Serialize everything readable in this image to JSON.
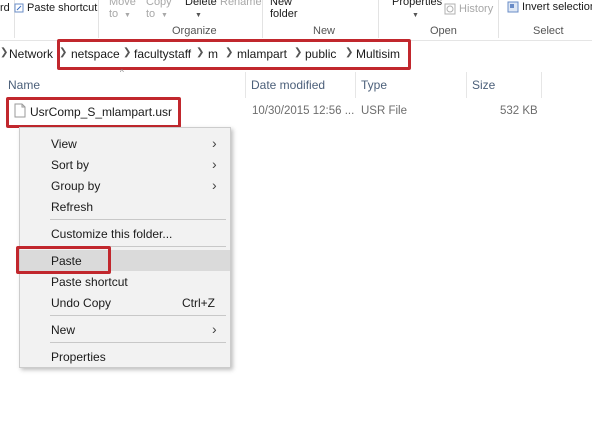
{
  "ribbon": {
    "clip_label": "rd",
    "paste_shortcut": "Paste shortcut",
    "move_to": [
      "Move",
      "to"
    ],
    "copy_to": [
      "Copy",
      "to"
    ],
    "delete": "Delete",
    "rename": "Rename",
    "new_folder": [
      "New",
      "folder"
    ],
    "properties": "Properties",
    "history": "History",
    "invert_selection": "Invert selection",
    "groups": {
      "organize": "Organize",
      "new": "New",
      "open": "Open",
      "select": "Select"
    }
  },
  "address": {
    "crumbs": [
      "Network",
      "netspace",
      "facultystaff",
      "m",
      "mlampart",
      "public",
      "Multisim"
    ]
  },
  "columns": {
    "name": "Name",
    "date": "Date modified",
    "type": "Type",
    "size": "Size"
  },
  "file": {
    "name": "UsrComp_S_mlampart.usr",
    "date": "10/30/2015 12:56 ...",
    "type": "USR File",
    "size": "532 KB"
  },
  "menu": {
    "view": "View",
    "sort_by": "Sort by",
    "group_by": "Group by",
    "refresh": "Refresh",
    "customize": "Customize this folder...",
    "paste": "Paste",
    "paste_shortcut": "Paste shortcut",
    "undo_copy": "Undo Copy",
    "undo_shortcut": "Ctrl+Z",
    "new": "New",
    "properties": "Properties"
  },
  "colors": {
    "highlight": "#c1272d",
    "menu_bg": "#f2f2f2",
    "hover": "#dadada",
    "header_text": "#4c607a"
  }
}
